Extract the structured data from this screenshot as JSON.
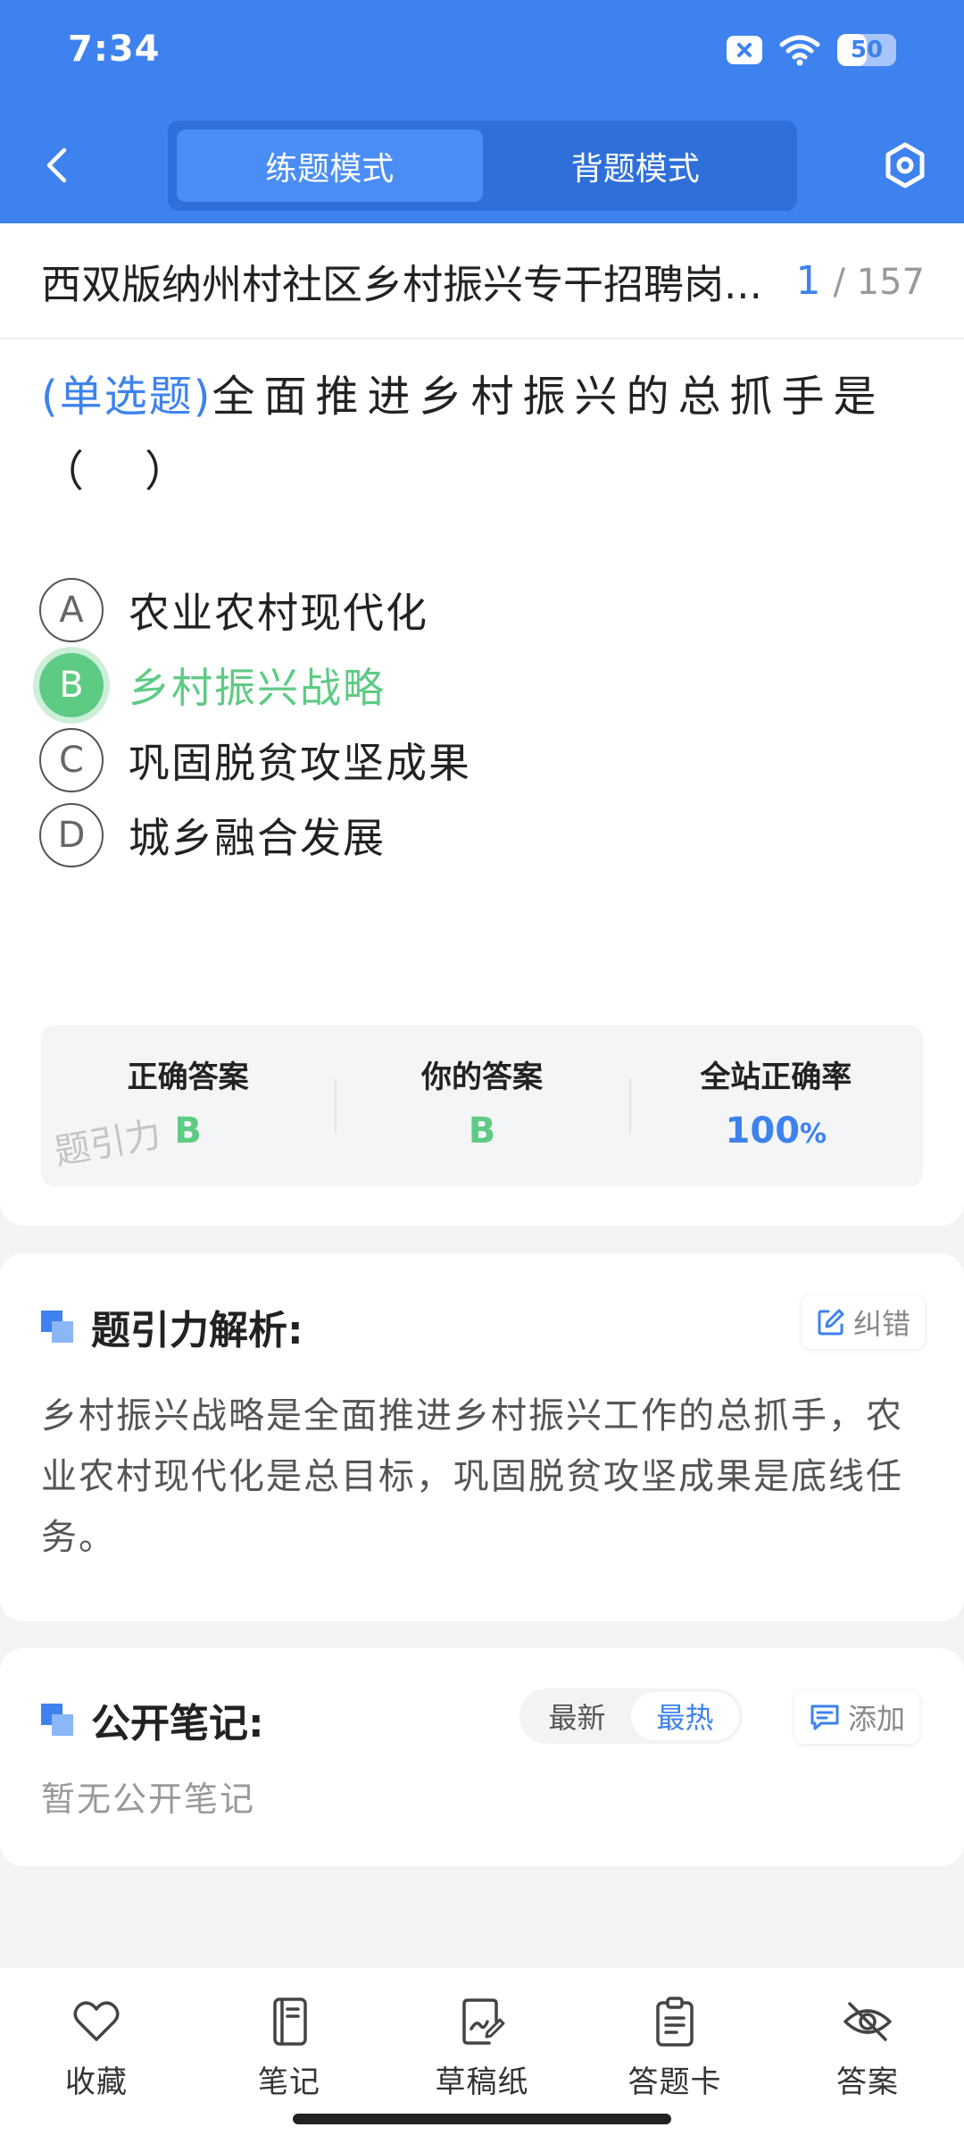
{
  "status_bar": {
    "time": "7:34",
    "battery_level": "50",
    "battery_fraction": 0.5
  },
  "header": {
    "modes": [
      {
        "label": "练题模式",
        "active": true
      },
      {
        "label": "背题模式",
        "active": false
      }
    ],
    "colors": {
      "primary": "#3d82ee",
      "correct": "#5dcb84"
    }
  },
  "question_card": {
    "paper_title": "西双版纳州村社区乡村振兴专干招聘岗...",
    "progress_current": "1",
    "progress_total": "/ 157",
    "question_type": "(单选题)",
    "question_text": "全面推进乡村振兴的总抓手是（　）",
    "options": [
      {
        "letter": "A",
        "text": "农业农村现代化",
        "state": "normal"
      },
      {
        "letter": "B",
        "text": "乡村振兴战略",
        "state": "correct"
      },
      {
        "letter": "C",
        "text": "巩固脱贫攻坚成果",
        "state": "normal"
      },
      {
        "letter": "D",
        "text": "城乡融合发展",
        "state": "normal"
      }
    ],
    "answer_summary": {
      "correct_label": "正确答案",
      "correct_value": "B",
      "yours_label": "你的答案",
      "yours_value": "B",
      "rate_label": "全站正确率",
      "rate_value": "100",
      "rate_unit": "%",
      "watermark": "题引力"
    }
  },
  "analysis": {
    "title": "题引力解析:",
    "report_button": "纠错",
    "text": "乡村振兴战略是全面推进乡村振兴工作的总抓手，农业农村现代化是总目标，巩固脱贫攻坚成果是底线任务。"
  },
  "notes": {
    "title": "公开笔记:",
    "sort_options": [
      {
        "label": "最新",
        "active": false
      },
      {
        "label": "最热",
        "active": true
      }
    ],
    "add_button": "添加",
    "empty_text": "暂无公开笔记"
  },
  "bottom_nav": [
    {
      "label": "收藏",
      "icon": "heart-icon"
    },
    {
      "label": "笔记",
      "icon": "notebook-icon"
    },
    {
      "label": "草稿纸",
      "icon": "draft-paper-icon"
    },
    {
      "label": "答题卡",
      "icon": "answer-sheet-icon"
    },
    {
      "label": "答案",
      "icon": "eye-off-icon"
    }
  ]
}
